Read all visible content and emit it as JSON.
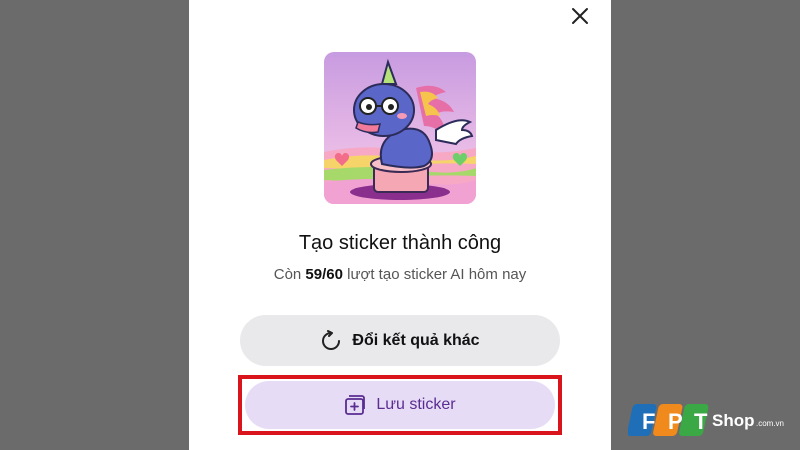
{
  "dialog": {
    "title": "Tạo sticker thành công",
    "subtitle_prefix": "Còn ",
    "quota": "59/60",
    "subtitle_suffix": " lượt tạo sticker AI hôm nay",
    "regenerate_label": "Đổi kết quả khác",
    "save_label": "Lưu sticker"
  },
  "icons": {
    "close": "close-icon",
    "regenerate": "refresh-icon",
    "save": "add-sticker-icon"
  },
  "watermark": {
    "brand_letters": [
      "F",
      "P",
      "T"
    ],
    "brand_name": "Shop",
    "domain": ".com.vn"
  },
  "colors": {
    "save_button_bg": "#e7dcf6",
    "save_button_text": "#5a2d91",
    "highlight_border": "#d9141d",
    "regen_button_bg": "#e9e9ec"
  }
}
